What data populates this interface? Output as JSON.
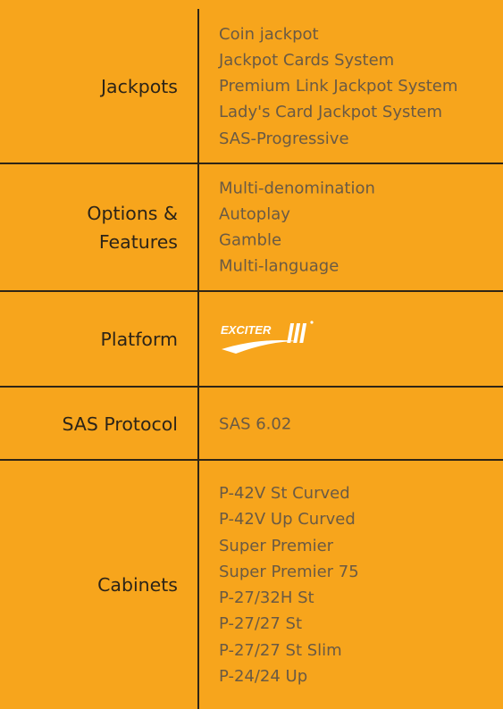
{
  "rows": [
    {
      "label": "Jackpots",
      "values": [
        "Coin jackpot",
        "Jackpot Cards System",
        "Premium Link Jackpot System",
        "Lady's Card Jackpot System",
        "SAS-Progressive"
      ]
    },
    {
      "label_lines": [
        "Options &",
        "Features"
      ],
      "values": [
        "Multi-denomination",
        "Autoplay",
        "Gamble",
        "Multi-language"
      ]
    },
    {
      "label": "Platform",
      "logo_text": "EXCITER",
      "logo_icon": "exciter-iii-logo"
    },
    {
      "label": "SAS Protocol",
      "values": [
        "SAS 6.02"
      ]
    },
    {
      "label": "Cabinets",
      "values": [
        "P-42V St Curved",
        "P-42V Up Curved",
        "Super Premier",
        "Super Premier 75",
        "P-27/32H St",
        "P-27/27 St",
        "P-27/27 St Slim",
        "P-24/24 Up"
      ]
    }
  ]
}
